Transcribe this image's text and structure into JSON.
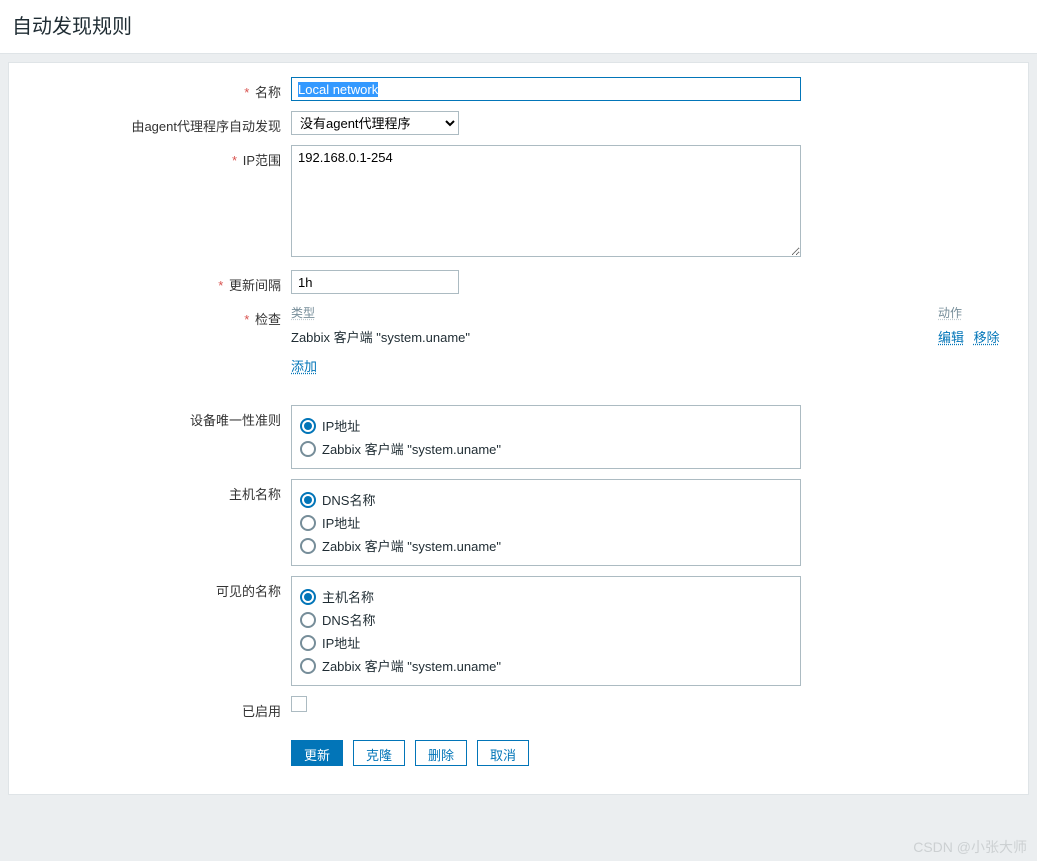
{
  "header": {
    "title": "自动发现规则"
  },
  "labels": {
    "name": "名称",
    "agent_discovery": "由agent代理程序自动发现",
    "ip_range": "IP范围",
    "update_interval": "更新间隔",
    "checks": "检查",
    "check_type_header": "类型",
    "check_action_header": "动作",
    "add_check": "添加",
    "edit": "编辑",
    "remove": "移除",
    "uniqueness": "设备唯一性准则",
    "hostname": "主机名称",
    "visible_name": "可见的名称",
    "enabled": "已启用"
  },
  "fields": {
    "name": "Local network",
    "agent_proxy_selected": "没有agent代理程序",
    "ip_range": "192.168.0.1-254",
    "update_interval": "1h"
  },
  "checks": [
    {
      "type_label": "Zabbix 客户端 \"system.uname\""
    }
  ],
  "uniqueness_options": [
    {
      "label": "IP地址",
      "checked": true
    },
    {
      "label": "Zabbix 客户端 \"system.uname\"",
      "checked": false
    }
  ],
  "hostname_options": [
    {
      "label": "DNS名称",
      "checked": true
    },
    {
      "label": "IP地址",
      "checked": false
    },
    {
      "label": "Zabbix 客户端 \"system.uname\"",
      "checked": false
    }
  ],
  "visible_name_options": [
    {
      "label": "主机名称",
      "checked": true
    },
    {
      "label": "DNS名称",
      "checked": false
    },
    {
      "label": "IP地址",
      "checked": false
    },
    {
      "label": "Zabbix 客户端 \"system.uname\"",
      "checked": false
    }
  ],
  "enabled": false,
  "buttons": {
    "update": "更新",
    "clone": "克隆",
    "delete": "删除",
    "cancel": "取消"
  },
  "watermark": "CSDN @小张大师"
}
